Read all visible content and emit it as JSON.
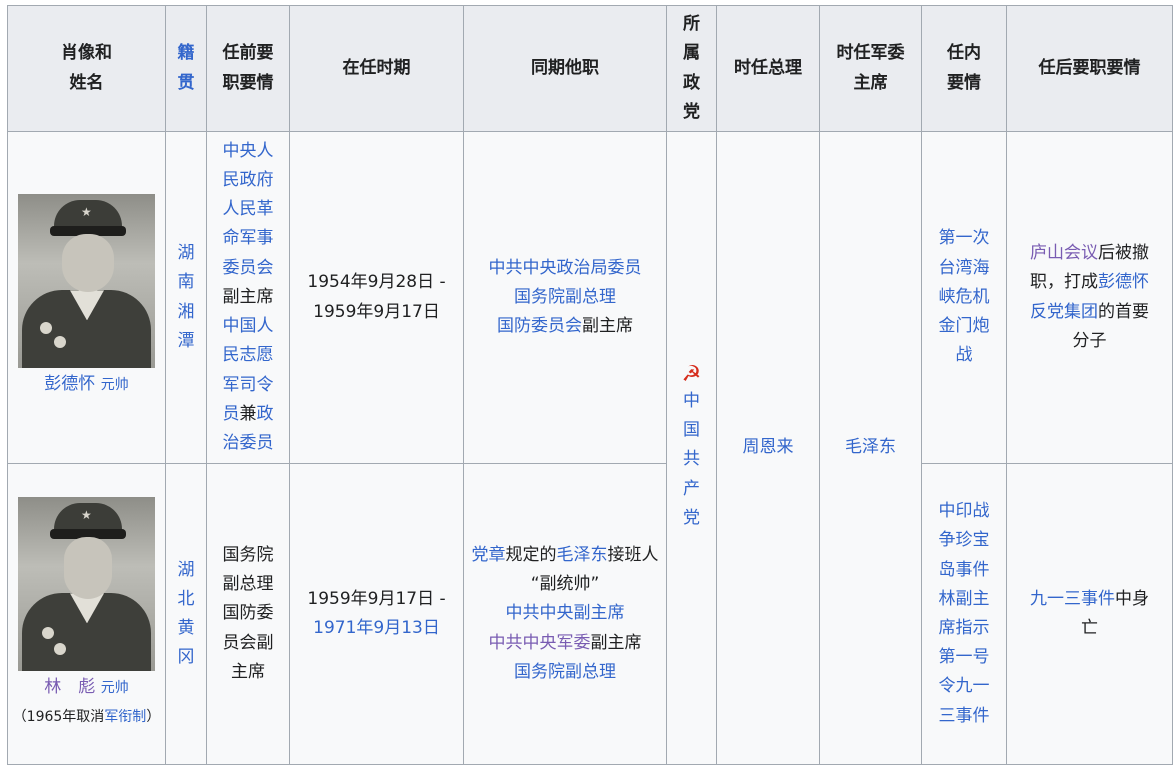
{
  "headers": {
    "portrait": "肖像和姓名",
    "origin": "籍贯",
    "prior": "任前要职要情",
    "term": "在任时期",
    "concurrent": "同期他职",
    "party": "所属政党",
    "premier": "时任总理",
    "cmc": "时任军委主席",
    "events": "任内要情",
    "after": "任后要职要情"
  },
  "rows": [
    {
      "name": "彭德怀",
      "rank": "元帅",
      "origin": "湖南湘潭",
      "prior": [
        "中央人民政府人民革命军事委员会",
        "副主席",
        "中国人民志愿军司令员",
        "兼",
        "政治委员"
      ],
      "term_start": "1954年9月28日 -",
      "term_end": "1959年9月17日",
      "concurrent": [
        "中共中央政治局委员",
        "国务院副总理",
        "国防委员会",
        "副主席"
      ],
      "events": [
        "第一次台湾海峡危机",
        "金门炮战"
      ],
      "after": [
        "庐山会议",
        "后被撤职，打成",
        "彭德怀反党集团",
        "的首要分子"
      ]
    },
    {
      "name": "林　彪",
      "rank": "元帅",
      "note_prefix": "（1965年取消",
      "note_link": "军衔制",
      "note_suffix": "）",
      "origin": "湖北黄冈",
      "prior": "国务院副总理国防委员会副主席",
      "term_start": "1959年9月17日 -",
      "term_end": "1971年9月13日",
      "concurrent": [
        "党章",
        "规定的",
        "毛泽东",
        "接班人",
        "“副统帅”",
        "中共中央副主席",
        "中共中央军委",
        "副主席",
        "国务院副总理"
      ],
      "events": [
        "中印战争",
        "珍宝岛事件",
        "林副主席指示第一号令",
        "九一三事件"
      ],
      "after": [
        "九一三事件",
        "中身亡"
      ]
    }
  ],
  "shared": {
    "party_icon": "hammer-sickle-icon",
    "party_symbol": "☭",
    "party": "中国共产党",
    "premier": "周恩来",
    "cmc": "毛泽东"
  },
  "colors": {
    "link": "#3366cc",
    "visited_link": "#795cb2",
    "header_bg": "#eaecf0",
    "cell_bg": "#f8f9fa",
    "border": "#a2a9b1"
  }
}
